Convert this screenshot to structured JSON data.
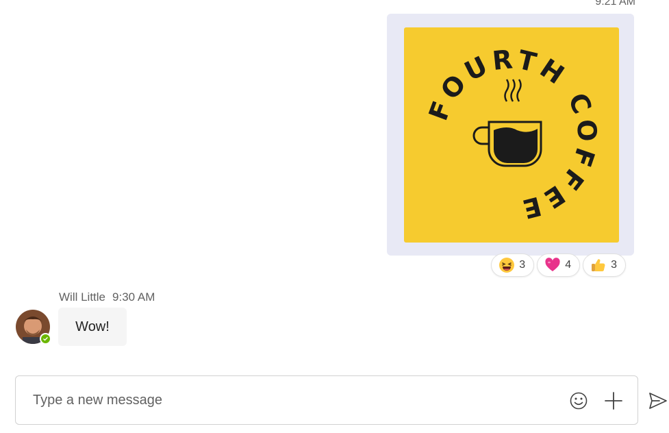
{
  "message_image": {
    "timestamp": "9:21 AM",
    "logo_text": "FOURTH COFFEE",
    "logo_colors": {
      "background": "#f6cb2f",
      "ink": "#1b1b1b"
    }
  },
  "reactions": [
    {
      "icon": "laughing-emoji",
      "count": "3"
    },
    {
      "icon": "heart-emoji",
      "count": "4"
    },
    {
      "icon": "thumbs-up-emoji",
      "count": "3"
    }
  ],
  "reply": {
    "sender": "Will Little",
    "time": "9:30 AM",
    "text": "Wow!",
    "presence": "available"
  },
  "composer": {
    "placeholder": "Type a new message",
    "icons": [
      "emoji-icon",
      "add-icon",
      "send-icon"
    ]
  },
  "colors": {
    "bubble": "#f5f5f5",
    "image_frame": "#e8e9f5",
    "presence_available": "#6bb700"
  }
}
